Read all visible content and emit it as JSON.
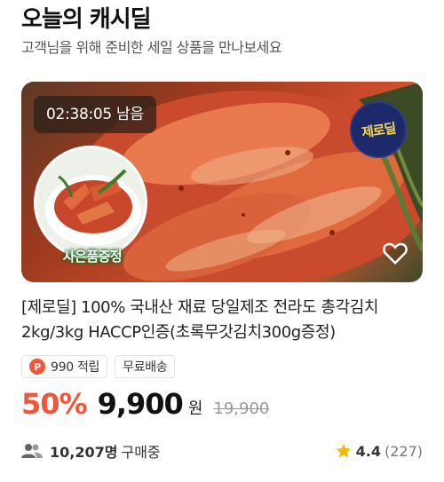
{
  "section": {
    "title": "오늘의 캐시딜",
    "subtitle": "고객님을 위해 준비한 세일 상품을 만나보세요"
  },
  "product": {
    "timer": "02:38:05 남음",
    "badge_text": "제로딜",
    "gift_label": "사은품증정",
    "name": "[제로딜] 100% 국내산 재료 당일제조 전라도 총각김치 2kg/3kg HACCP인증(초록무갓김치300g증정)",
    "point_icon_text": "P",
    "points_label": "990 적립",
    "shipping_label": "무료배송",
    "discount": "50%",
    "price": "9,900",
    "currency": "원",
    "original_price": "19,900",
    "buyers_count": "10,207명",
    "buyers_suffix": "구매중",
    "rating": "4.4",
    "review_count": "(227)"
  },
  "icons": {
    "heart": "heart-icon",
    "people": "people-icon",
    "star": "star-icon",
    "point": "point-icon"
  },
  "colors": {
    "accent": "#f0563a",
    "star": "#f6b800",
    "badge_bg": "#1c2a6b",
    "badge_text": "#f6d64a"
  }
}
